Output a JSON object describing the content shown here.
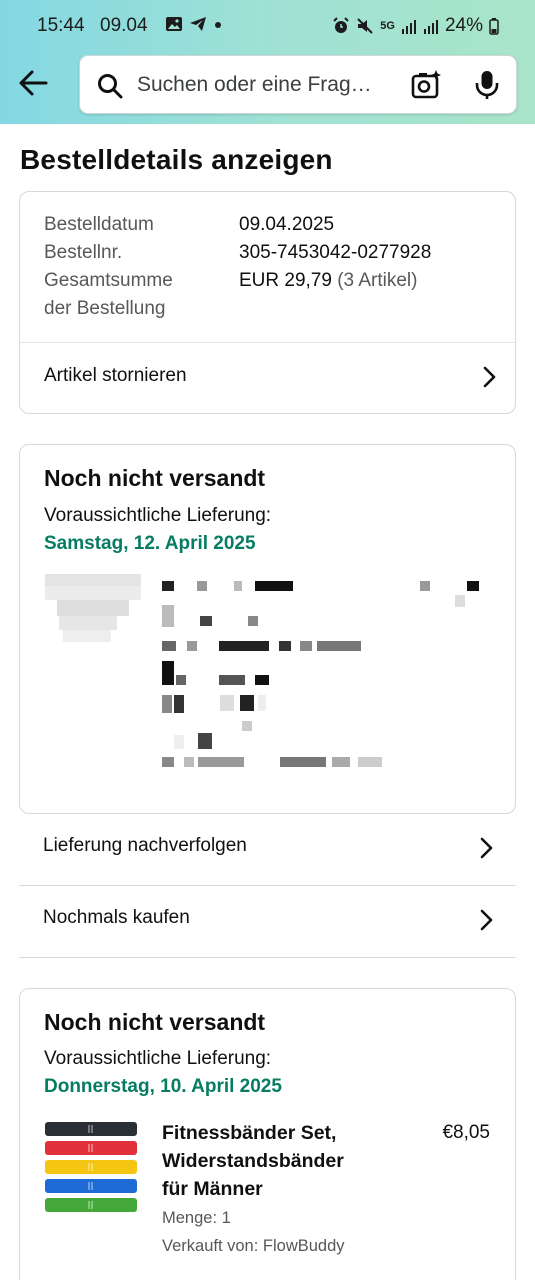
{
  "status_bar": {
    "time": "15:44",
    "date": "09.04",
    "network": "5G",
    "battery": "24%"
  },
  "search": {
    "placeholder": "Suchen oder eine Frag…"
  },
  "page": {
    "title": "Bestelldetails anzeigen"
  },
  "order": {
    "labels": {
      "date": "Bestelldatum",
      "number": "Bestellnr.",
      "total_line1": "Gesamtsumme",
      "total_line2": "der Bestellung"
    },
    "date": "09.04.2025",
    "number": "305-7453042-0277928",
    "total": "EUR 29,79",
    "items_count": "(3 Artikel)",
    "cancel_label": "Artikel stornieren"
  },
  "shipment1": {
    "status": "Noch nicht versandt",
    "delivery_label": "Voraussichtliche Lieferung:",
    "delivery_date": "Samstag, 12. April 2025"
  },
  "actions": {
    "track": "Lieferung nachverfolgen",
    "buy_again": "Nochmals kaufen"
  },
  "shipment2": {
    "status": "Noch nicht versandt",
    "delivery_label": "Voraussichtliche Lieferung:",
    "delivery_date": "Donnerstag, 10. April 2025",
    "item": {
      "name": "Fitnessbänder Set, Widerstandsbänder für Männer",
      "price": "€8,05",
      "quantity": "Menge: 1",
      "seller": "Verkauft von: FlowBuddy"
    }
  },
  "colors": {
    "header_gradient_start": "#84d8e3",
    "header_gradient_end": "#a8e4c9",
    "delivery_green": "#067d62"
  }
}
